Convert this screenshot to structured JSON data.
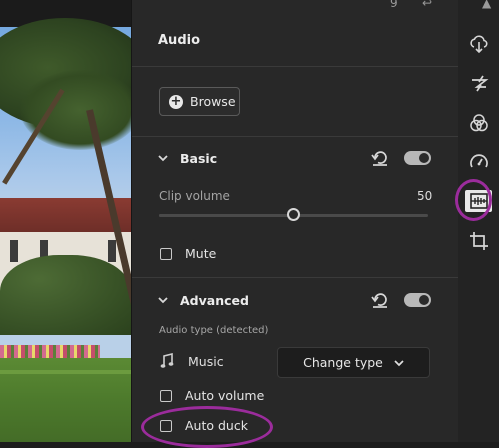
{
  "panel": {
    "title": "Audio",
    "browse_label": "Browse"
  },
  "basic": {
    "label": "Basic",
    "enabled": true,
    "clip_volume_label": "Clip volume",
    "clip_volume_value": "50",
    "clip_volume_fraction": 0.5,
    "mute_label": "Mute"
  },
  "advanced": {
    "label": "Advanced",
    "enabled": true,
    "audio_type_caption": "Audio type (detected)",
    "audio_type_value": "Music",
    "change_type_label": "Change type",
    "auto_volume_label": "Auto volume",
    "auto_duck_label": "Auto duck"
  },
  "rail": {
    "icons": [
      "cloud-download-icon",
      "lightning-icon",
      "color-circles-icon",
      "speed-gauge-icon",
      "audio-track-icon",
      "crop-icon"
    ],
    "selected": "audio-track-icon"
  },
  "colors": {
    "annotation_ring": "#9b2c9c",
    "panel_bg": "#282828"
  }
}
